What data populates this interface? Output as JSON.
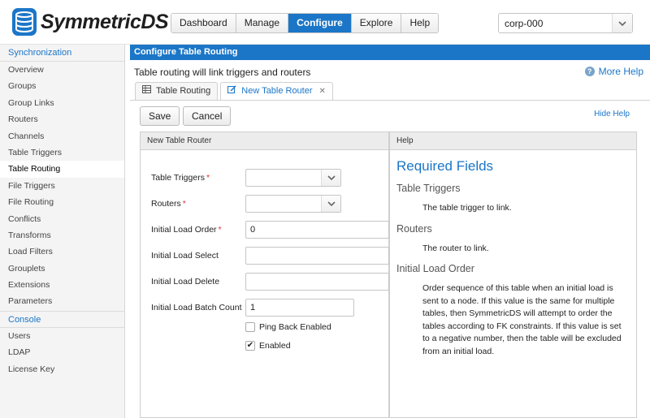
{
  "brand": {
    "name": "SymmetricDS"
  },
  "nav": {
    "tabs": [
      "Dashboard",
      "Manage",
      "Configure",
      "Explore",
      "Help"
    ],
    "active": "Configure"
  },
  "node_select": {
    "value": "corp-000"
  },
  "sidebar": {
    "section_sync": "Synchronization",
    "items": [
      "Overview",
      "Groups",
      "Group Links",
      "Routers",
      "Channels",
      "Table Triggers",
      "Table Routing",
      "File Triggers",
      "File Routing",
      "Conflicts",
      "Transforms",
      "Load Filters",
      "Grouplets",
      "Extensions",
      "Parameters"
    ],
    "active": "Table Routing",
    "section_console": "Console",
    "console_items": [
      "Users",
      "LDAP",
      "License Key"
    ]
  },
  "page": {
    "title": "Configure Table Routing",
    "description": "Table routing will link triggers and routers",
    "more_help": "More Help",
    "tabs": {
      "list_tab": "Table Routing",
      "new_tab": "New Table Router"
    },
    "save_label": "Save",
    "cancel_label": "Cancel",
    "hide_help": "Hide Help"
  },
  "form": {
    "panel_title": "New Table Router",
    "table_triggers_label": "Table Triggers",
    "routers_label": "Routers",
    "initial_load_order_label": "Initial Load Order",
    "initial_load_order_value": "0",
    "initial_load_select_label": "Initial Load Select",
    "initial_load_delete_label": "Initial Load Delete",
    "initial_load_batch_count_label": "Initial Load Batch Count",
    "initial_load_batch_count_value": "1",
    "ping_back_label": "Ping Back Enabled",
    "ping_back_checked": false,
    "enabled_label": "Enabled",
    "enabled_checked": true
  },
  "help": {
    "panel_title": "Help",
    "heading": "Required Fields",
    "table_triggers_h": "Table Triggers",
    "table_triggers_p": "The table trigger to link.",
    "routers_h": "Routers",
    "routers_p": "The router to link.",
    "initial_load_order_h": "Initial Load Order",
    "initial_load_order_p": "Order sequence of this table when an initial load is sent to a node. If this value is the same for multiple tables, then SymmetricDS will attempt to order the tables according to FK constraints. If this value is set to a negative number, then the table will be excluded from an initial load."
  },
  "colors": {
    "accent": "#1b76c7",
    "required": "#dd3333"
  }
}
